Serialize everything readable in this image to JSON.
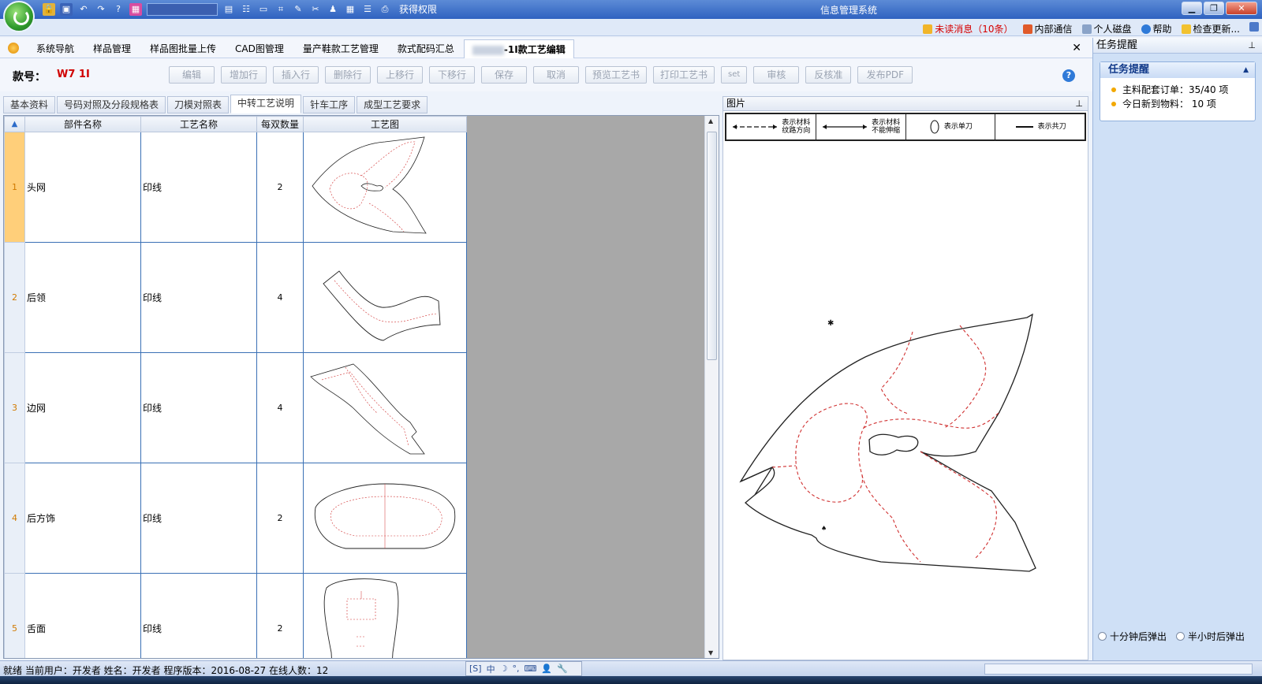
{
  "window": {
    "title": "信息管理系统",
    "permission_label": "获得权限"
  },
  "topbar": {
    "unread": "未读消息（10条）",
    "internal": "内部通信",
    "disk": "个人磁盘",
    "help": "帮助",
    "update": "检查更新..."
  },
  "nav": {
    "items": [
      "系统导航",
      "样品管理",
      "样品图批量上传",
      "CAD图管理",
      "量产鞋款工艺管理",
      "款式配码汇总"
    ],
    "active_tab": "-1I款工艺编辑",
    "close": "✕"
  },
  "form": {
    "kuanhao_label": "款号：",
    "kuanhao_value": "W7    1I"
  },
  "actions": [
    "编辑",
    "增加行",
    "插入行",
    "删除行",
    "上移行",
    "下移行",
    "保存",
    "取消",
    "预览工艺书",
    "打印工艺书",
    "set",
    "审核",
    "反核准",
    "发布PDF"
  ],
  "subtabs": [
    "基本资料",
    "号码对照及分段规格表",
    "刀模对照表",
    "中转工艺说明",
    "针车工序",
    "成型工艺要求"
  ],
  "grid": {
    "headers": [
      "部件名称",
      "工艺名称",
      "每双数量",
      "工艺图"
    ],
    "rows": [
      {
        "num": "1",
        "part": "头网",
        "process": "印线",
        "qty": "2",
        "img": "vamp"
      },
      {
        "num": "2",
        "part": "后领",
        "process": "印线",
        "qty": "4",
        "img": "collar"
      },
      {
        "num": "3",
        "part": "边网",
        "process": "印线",
        "qty": "4",
        "img": "side"
      },
      {
        "num": "4",
        "part": "后方饰",
        "process": "印线",
        "qty": "2",
        "img": "heel"
      },
      {
        "num": "5",
        "part": "舌面",
        "process": "印线",
        "qty": "2",
        "img": "tongue"
      }
    ]
  },
  "image_pane": {
    "title": "图片",
    "legend": [
      {
        "text1": "表示材料",
        "text2": "纹路方向"
      },
      {
        "text1": "表示材料",
        "text2": "不能伸缩"
      },
      {
        "text1": "表示单刀",
        "text2": ""
      },
      {
        "text1": "表示共刀",
        "text2": ""
      }
    ]
  },
  "task_panel": {
    "title": "任务提醒",
    "card_title": "任务提醒",
    "items": [
      "主料配套订单：35/40 项",
      "今日新到物料： 10 项"
    ],
    "options": [
      "十分钟后弹出",
      "半小时后弹出"
    ]
  },
  "status": {
    "text": "就绪  当前用户：开发者  姓名：开发者  程序版本：2016-08-27  在线人数：12",
    "ime": [
      "中",
      "☽",
      "°,",
      "⌨",
      "👤",
      "🔧"
    ]
  },
  "colors": {
    "accent_red": "#d00000",
    "grid_border": "#3a70b5",
    "dashed": "#d03030"
  }
}
